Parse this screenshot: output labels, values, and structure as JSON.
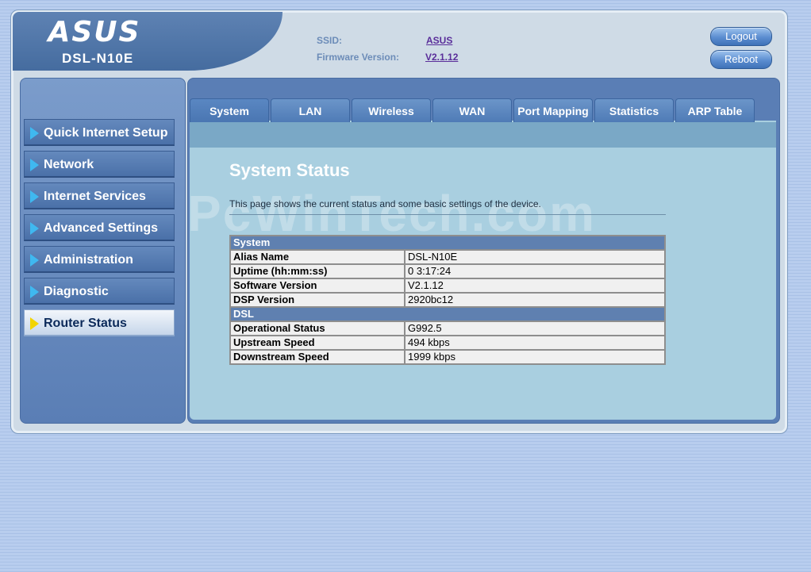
{
  "header": {
    "logo": "ASUS",
    "model": "DSL-N10E",
    "ssid_label": "SSID:",
    "ssid_value": "ASUS",
    "firmware_label": "Firmware Version:",
    "firmware_value": "V2.1.12",
    "logout_label": "Logout",
    "reboot_label": "Reboot"
  },
  "sidebar": {
    "items": [
      {
        "label": "Quick Internet Setup",
        "active": false
      },
      {
        "label": "Network",
        "active": false
      },
      {
        "label": "Internet Services",
        "active": false
      },
      {
        "label": "Advanced Settings",
        "active": false
      },
      {
        "label": "Administration",
        "active": false
      },
      {
        "label": "Diagnostic",
        "active": false
      },
      {
        "label": "Router Status",
        "active": true
      }
    ]
  },
  "tabs": [
    {
      "label": "System"
    },
    {
      "label": "LAN"
    },
    {
      "label": "Wireless"
    },
    {
      "label": "WAN"
    },
    {
      "label": "Port Mapping"
    },
    {
      "label": "Statistics"
    },
    {
      "label": "ARP Table"
    }
  ],
  "main": {
    "title": "System Status",
    "description": "This page shows the current status and some basic settings of the device.",
    "watermark": "PcWinTech.com"
  },
  "table": {
    "system_header": "System",
    "system_rows": [
      {
        "key": "Alias Name",
        "value": "DSL-N10E"
      },
      {
        "key": "Uptime (hh:mm:ss)",
        "value": "0 3:17:24"
      },
      {
        "key": "Software Version",
        "value": "V2.1.12"
      },
      {
        "key": "DSP Version",
        "value": "2920bc12"
      }
    ],
    "dsl_header": "DSL",
    "dsl_rows": [
      {
        "key": "Operational Status",
        "value": "G992.5"
      },
      {
        "key": "Upstream Speed",
        "value": "494 kbps"
      },
      {
        "key": "Downstream Speed",
        "value": "1999 kbps"
      }
    ]
  },
  "colors": {
    "accent": "#5f80b0",
    "active_arrow": "#f2d400",
    "arrow": "#3fb8f0"
  }
}
